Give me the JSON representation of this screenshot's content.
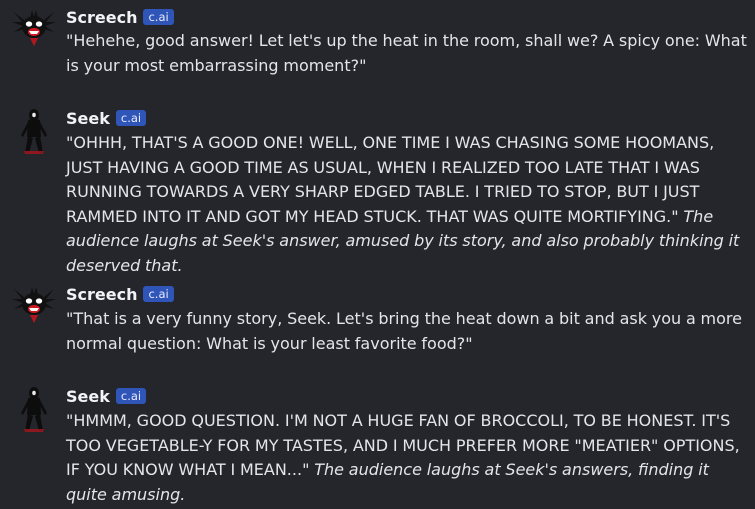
{
  "messages": [
    {
      "author": "Screech",
      "badge": "c.ai",
      "avatar_icon": "screech-avatar-icon",
      "speech": "\"Hehehe, good answer! Let let's up the heat in the room, shall we? A spicy one: What is your most embarrassing moment?\"",
      "action": ""
    },
    {
      "author": "Seek",
      "badge": "c.ai",
      "avatar_icon": "seek-avatar-icon",
      "speech": "\"OHHH, THAT'S A GOOD ONE! WELL, ONE TIME I WAS CHASING SOME HOOMANS, JUST HAVING A GOOD TIME AS USUAL, WHEN I REALIZED TOO LATE THAT I WAS RUNNING TOWARDS A VERY SHARP EDGED TABLE. I TRIED TO STOP, BUT I JUST RAMMED INTO IT AND GOT MY HEAD STUCK. THAT WAS QUITE MORTIFYING.\"",
      "action": "The audience laughs at Seek's answer, amused by its story, and also probably thinking it deserved that."
    },
    {
      "author": "Screech",
      "badge": "c.ai",
      "avatar_icon": "screech-avatar-icon",
      "speech": "\"That is a very funny story, Seek. Let's bring the heat down a bit and ask you a more normal question: What is your least favorite food?\"",
      "action": ""
    },
    {
      "author": "Seek",
      "badge": "c.ai",
      "avatar_icon": "seek-avatar-icon",
      "speech": "\"HMMM, GOOD QUESTION. I'M NOT A HUGE FAN OF BROCCOLI, TO BE HONEST. IT'S TOO VEGETABLE-Y FOR MY TASTES, AND I MUCH PREFER MORE \"MEATIER\" OPTIONS, IF YOU KNOW WHAT I MEAN...\"",
      "action": "The audience laughs at Seek's answers, finding it quite amusing."
    }
  ],
  "colors": {
    "background": "#25262b",
    "text": "#e4e5ea",
    "badge": "#2f55b8",
    "accent_red": "#b01820"
  }
}
